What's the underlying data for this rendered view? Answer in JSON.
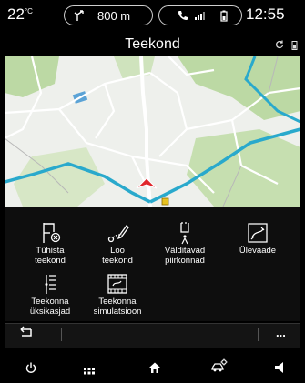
{
  "status": {
    "temperature": "22",
    "temperature_unit": "°C",
    "distance": "800 m",
    "time": "12:55"
  },
  "header": {
    "title": "Teekond"
  },
  "menu": {
    "items": [
      {
        "label_line1": "Tühista",
        "label_line2": "teekond",
        "icon": "cancel-route-icon"
      },
      {
        "label_line1": "Loo",
        "label_line2": "teekond",
        "icon": "create-route-icon"
      },
      {
        "label_line1": "Välditavad",
        "label_line2": "piirkonnad",
        "icon": "avoid-areas-icon"
      },
      {
        "label_line1": "Ülevaade",
        "label_line2": "",
        "icon": "overview-icon"
      },
      {
        "label_line1": "Teekonna",
        "label_line2": "üksikasjad",
        "icon": "route-details-icon"
      },
      {
        "label_line1": "Teekonna",
        "label_line2": "simulatsioon",
        "icon": "route-simulation-icon"
      }
    ]
  },
  "actionbar": {
    "back_icon": "back-arrow-icon",
    "more_label": "..."
  },
  "bottombar": {
    "icons": [
      "power-icon",
      "apps-grid-icon",
      "home-icon",
      "car-settings-icon",
      "volume-icon"
    ]
  },
  "colors": {
    "route": "#29a9cc",
    "road_major": "#ffffff",
    "green_area": "#bcd9a4",
    "water": "#5ba3d6",
    "car_arrow": "#e0262b",
    "background": "#000000"
  }
}
